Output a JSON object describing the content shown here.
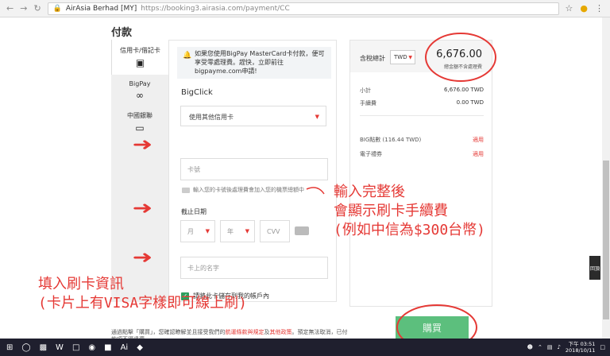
{
  "browser": {
    "back_icon": "arrow-left-icon",
    "forward_icon": "arrow-right-icon",
    "reload_icon": "reload-icon",
    "site_label": "AirAsia Berhad [MY]",
    "url": "https://booking3.airasia.com/payment/CC"
  },
  "page": {
    "title": "付款"
  },
  "tabs": [
    {
      "label": "信用卡/借記卡",
      "icon": "credit-card-icon"
    },
    {
      "label": "BigPay",
      "icon": "bigpay-icon"
    },
    {
      "label": "中國銀聯",
      "icon": "monitor-icon"
    }
  ],
  "form": {
    "notice": "如果您使用BigPay MasterCard卡付款，便可享受零處理費。趕快，立即前往bigpayme.com申請!",
    "brand": "BigClick",
    "card_select": "使用其他信用卡",
    "card_number_placeholder": "卡號",
    "card_hint": "輸入您的卡號後處理費會加入您的機票總額中",
    "expiry_label": "截止日期",
    "month_placeholder": "月",
    "year_placeholder": "年",
    "cvv_placeholder": "CVV",
    "name_placeholder": "卡上的名字",
    "save_label": "請將此卡儲存到我的帳戶內"
  },
  "summary": {
    "total_label": "含稅總計",
    "currency": "TWD",
    "total": "6,676.00",
    "tax_note": "總金額不含處理費",
    "subtotal_label": "小計",
    "subtotal_value": "6,676.00 TWD",
    "fee_label": "手續費",
    "fee_value": "0.00 TWD",
    "big_label": "BIG點數 (116.44 TWD)",
    "big_action": "適用",
    "voucher_label": "電子禮券",
    "voucher_action": "適用"
  },
  "buy_label": "購買",
  "terms": {
    "prefix": "通過點擊「購買」，您確認瞭解並且接受我們的",
    "link1": "航運條款與規定",
    "and": "及",
    "link2": "其他政策",
    "suffix": "。預定無法取消，已付款項不得退還。"
  },
  "annotations": {
    "right_line1": "輸入完整後",
    "right_line2": "會顯示刷卡手續費",
    "right_line3": "(例如中信為$300台幣)",
    "left_line1": "填入刷卡資訊",
    "left_line2": "(卡片上有VISA字樣即可線上刷)"
  },
  "sidebtn": "回頂",
  "taskbar": {
    "time": "下午 03:51",
    "date": "2018/10/11"
  },
  "colors": {
    "accent_red": "#e53935",
    "buy_green": "#5cbf7d"
  }
}
